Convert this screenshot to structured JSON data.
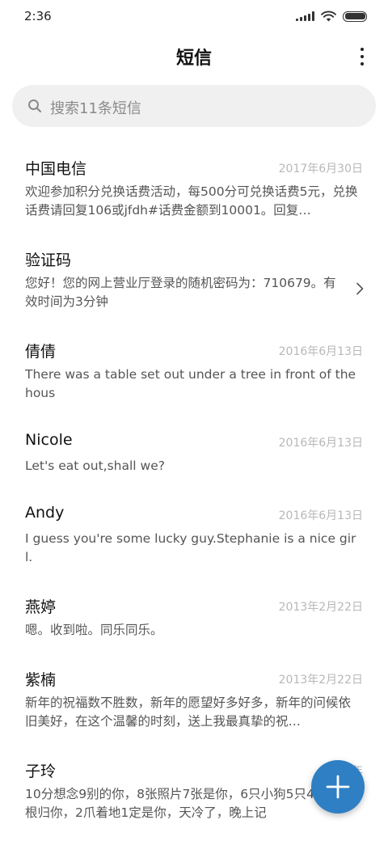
{
  "status_bar": {
    "time": "2:36",
    "icons": [
      "signal-icon",
      "wifi-icon",
      "battery-icon"
    ]
  },
  "header": {
    "title": "短信",
    "menu_icon": "more-vertical-icon"
  },
  "search": {
    "placeholder": "搜索11条短信",
    "icon": "search-icon"
  },
  "messages": [
    {
      "name": "中国电信",
      "date": "2017年6月30日",
      "preview": "欢迎参加积分兑换话费活动，每500分可兑换话费5元，兑换话费请回复106或jfdh#话费金额到10001。回复…"
    },
    {
      "name": "验证码",
      "date": "",
      "preview": "您好！您的网上营业厅登录的随机密码为：710679。有效时间为3分钟"
    },
    {
      "name": "倩倩",
      "date": "2016年6月13日",
      "preview": "There was a table set out under a tree in front of the hous"
    },
    {
      "name": "Nicole",
      "date": "2016年6月13日",
      "preview": "Let's eat out,shall we?"
    },
    {
      "name": "Andy",
      "date": "2016年6月13日",
      "preview": "I guess you're some lucky guy.Stephanie is a nice girl."
    },
    {
      "name": "燕婷",
      "date": "2013年2月22日",
      "preview": "嗯。收到啦。同乐同乐。"
    },
    {
      "name": "紫楠",
      "date": "2013年2月22日",
      "preview": "新年的祝福数不胜数，新年的愿望好多好多，新年的问候依旧美好，在这个温馨的时刻，送上我最真挚的祝…"
    },
    {
      "name": "子玲",
      "date": "2013年",
      "preview": "10分想念9别的你，8张照片7张是你，6只小狗5只4根骨头3根归你，2爪着地1定是你，天冷了，晚上记"
    }
  ],
  "fab": {
    "icon": "plus-icon",
    "color": "#2e7fc4"
  }
}
